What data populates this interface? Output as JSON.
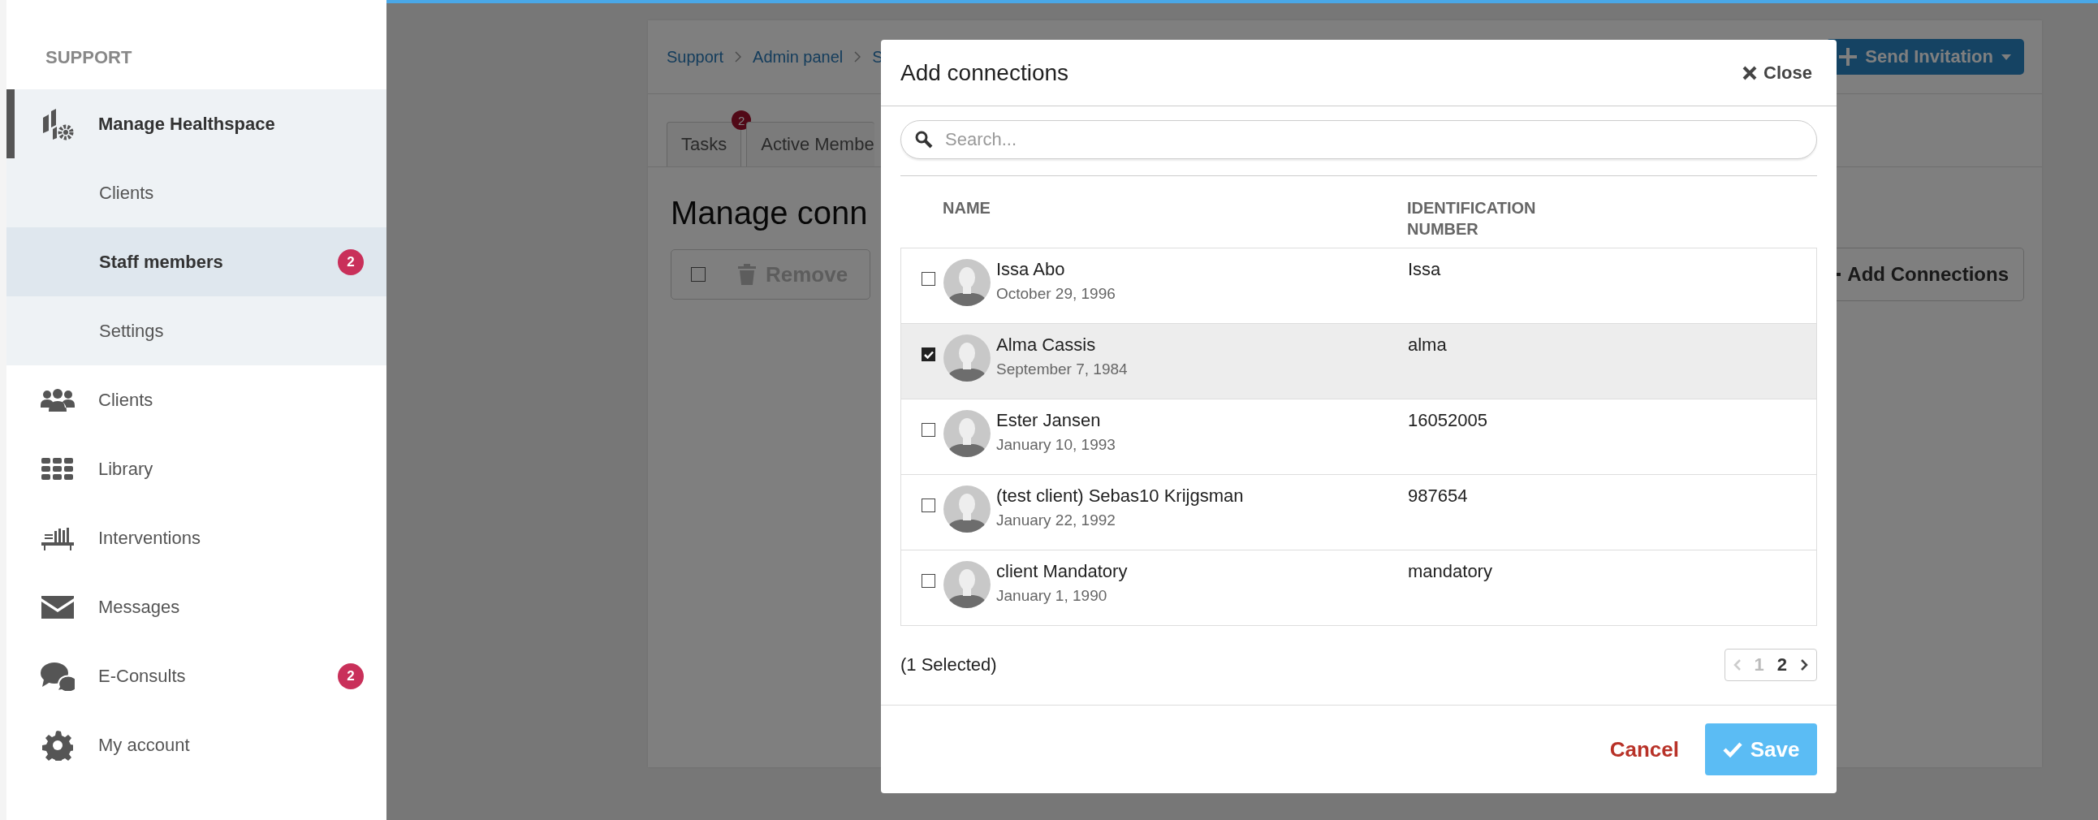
{
  "sidebar": {
    "section_title": "SUPPORT",
    "items": [
      {
        "label": "Manage Healthspace",
        "expanded": true,
        "children": [
          {
            "label": "Clients",
            "selected": false
          },
          {
            "label": "Staff members",
            "selected": true,
            "badge": "2"
          },
          {
            "label": "Settings",
            "selected": false
          }
        ]
      },
      {
        "label": "Clients"
      },
      {
        "label": "Library"
      },
      {
        "label": "Interventions"
      },
      {
        "label": "Messages"
      },
      {
        "label": "E-Consults",
        "badge": "2"
      },
      {
        "label": "My account"
      }
    ]
  },
  "background_page": {
    "breadcrumb": [
      "Support",
      "Admin panel",
      "S"
    ],
    "invite_button": "Send Invitation",
    "tabs": [
      {
        "label": "Tasks",
        "badge": "2"
      },
      {
        "label": "Active Membe"
      }
    ],
    "heading": "Manage conn",
    "select_all_checked": false,
    "remove_button": "Remove",
    "add_button": "Add Connections"
  },
  "modal": {
    "title": "Add connections",
    "close": "Close",
    "search": {
      "placeholder": "Search..."
    },
    "columns": [
      "NAME",
      "IDENTIFICATION NUMBER"
    ],
    "rows": [
      {
        "name": "Issa Abo",
        "date": "October 29, 1996",
        "id": "Issa",
        "checked": false
      },
      {
        "name": "Alma Cassis",
        "date": "September 7, 1984",
        "id": "alma",
        "checked": true
      },
      {
        "name": "Ester Jansen",
        "date": "January 10, 1993",
        "id": "16052005",
        "checked": false
      },
      {
        "name": "(test client) Sebas10 Krijgsman",
        "date": "January 22, 1992",
        "id": "987654",
        "checked": false
      },
      {
        "name": "client Mandatory",
        "date": "January 1, 1990",
        "id": "mandatory",
        "checked": false
      }
    ],
    "selection_count": "(1 Selected)",
    "pagination": [
      {
        "label": "1",
        "selected": false
      },
      {
        "label": "2",
        "selected": true
      }
    ],
    "cancel": "Cancel",
    "save": "Save"
  }
}
